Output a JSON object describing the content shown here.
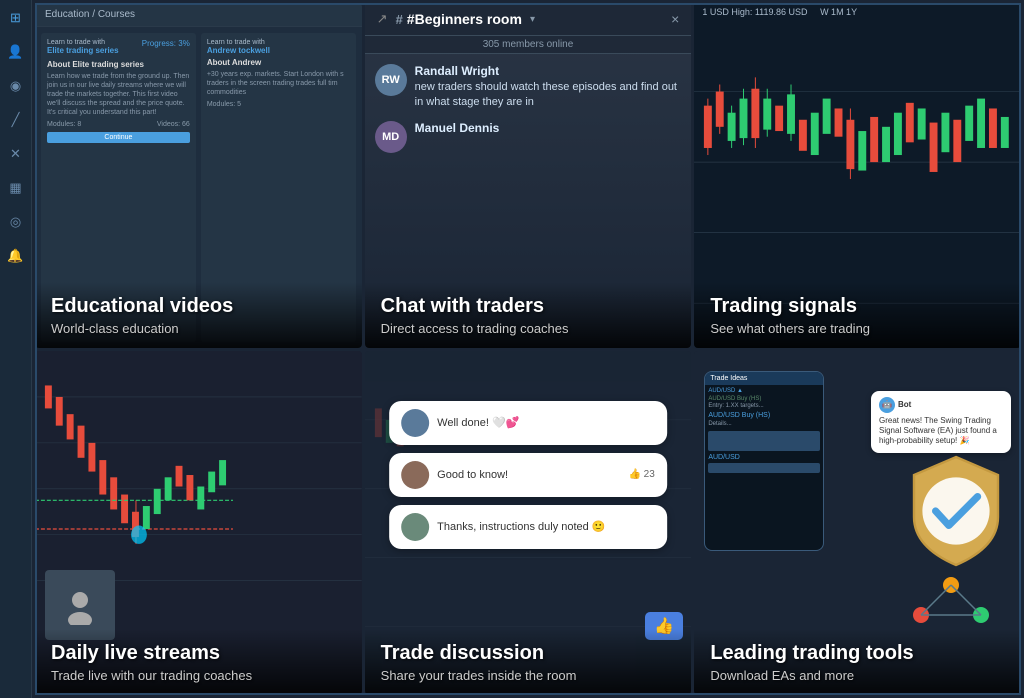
{
  "sidebar": {
    "icons": [
      {
        "name": "home-icon",
        "symbol": "⊞"
      },
      {
        "name": "user-icon",
        "symbol": "👤"
      },
      {
        "name": "circle-icon",
        "symbol": "◉"
      },
      {
        "name": "chart-icon",
        "symbol": "📈"
      },
      {
        "name": "cross-icon",
        "symbol": "✕"
      },
      {
        "name": "book-icon",
        "symbol": "📚"
      },
      {
        "name": "eye-icon",
        "symbol": "👁"
      },
      {
        "name": "bell-icon",
        "symbol": "🔔"
      }
    ]
  },
  "cards": {
    "educational": {
      "title": "Educational videos",
      "subtitle": "World-class education",
      "header": "Education / Courses",
      "course1": {
        "name": "Learn to trade with",
        "series": "Elite trading series",
        "progress": "Progress: 3%",
        "about_title": "About Elite trading series",
        "about_text": "Learn how we trade from the ground up. Then join us in our live daily streams where we will trade the markets together. This first video we'll discuss the spread and the price quote. It's critical you understand this part!",
        "modules": "Modules: 8",
        "videos": "Videos: 66",
        "btn": "Continue"
      },
      "course2": {
        "name": "Learn to trade with",
        "series": "Andrew tockwell",
        "about_title": "About Andrew",
        "about_text": "+30 years exp. markets. Start London with s traders in the screen trading trades full tim commodities",
        "modules": "Modules: 5"
      }
    },
    "chat": {
      "title": "Chat with traders",
      "subtitle": "Direct access to trading coaches",
      "room": "#Beginners room",
      "members": "305 members online",
      "close": "×",
      "messages": [
        {
          "name": "Randall Wright",
          "initials": "RW",
          "text": "new traders should watch these episodes and find out in what stage they are in"
        },
        {
          "name": "Manuel Dennis",
          "initials": "MD",
          "text": ""
        }
      ]
    },
    "signals": {
      "title": "Trading signals",
      "subtitle": "See what others are trading",
      "header": "1 USD  High: 1119.86 USD"
    },
    "live": {
      "title": "Daily live streams",
      "subtitle": "Trade live with our trading coaches"
    },
    "discussion": {
      "title": "Trade discussion",
      "subtitle": "Share your trades inside the room",
      "bubbles": [
        {
          "text": "Well done! 🤍💕",
          "likes": ""
        },
        {
          "text": "Good to know!",
          "likes": "23"
        },
        {
          "text": "Thanks, instructions duly noted 🙂",
          "likes": ""
        }
      ]
    },
    "tools": {
      "title": "Leading trading tools",
      "subtitle": "Download EAs and more",
      "bot_message": "Great news! The Swing Trading Signal Software (EA) just found a high-probability setup! 🎉",
      "phone_header": "Trade Ideas",
      "pair1": "AUD/USD Buy (HS)",
      "pair2": "AUD/USD Buy (HS)",
      "pair3": "AUD/USD"
    }
  }
}
